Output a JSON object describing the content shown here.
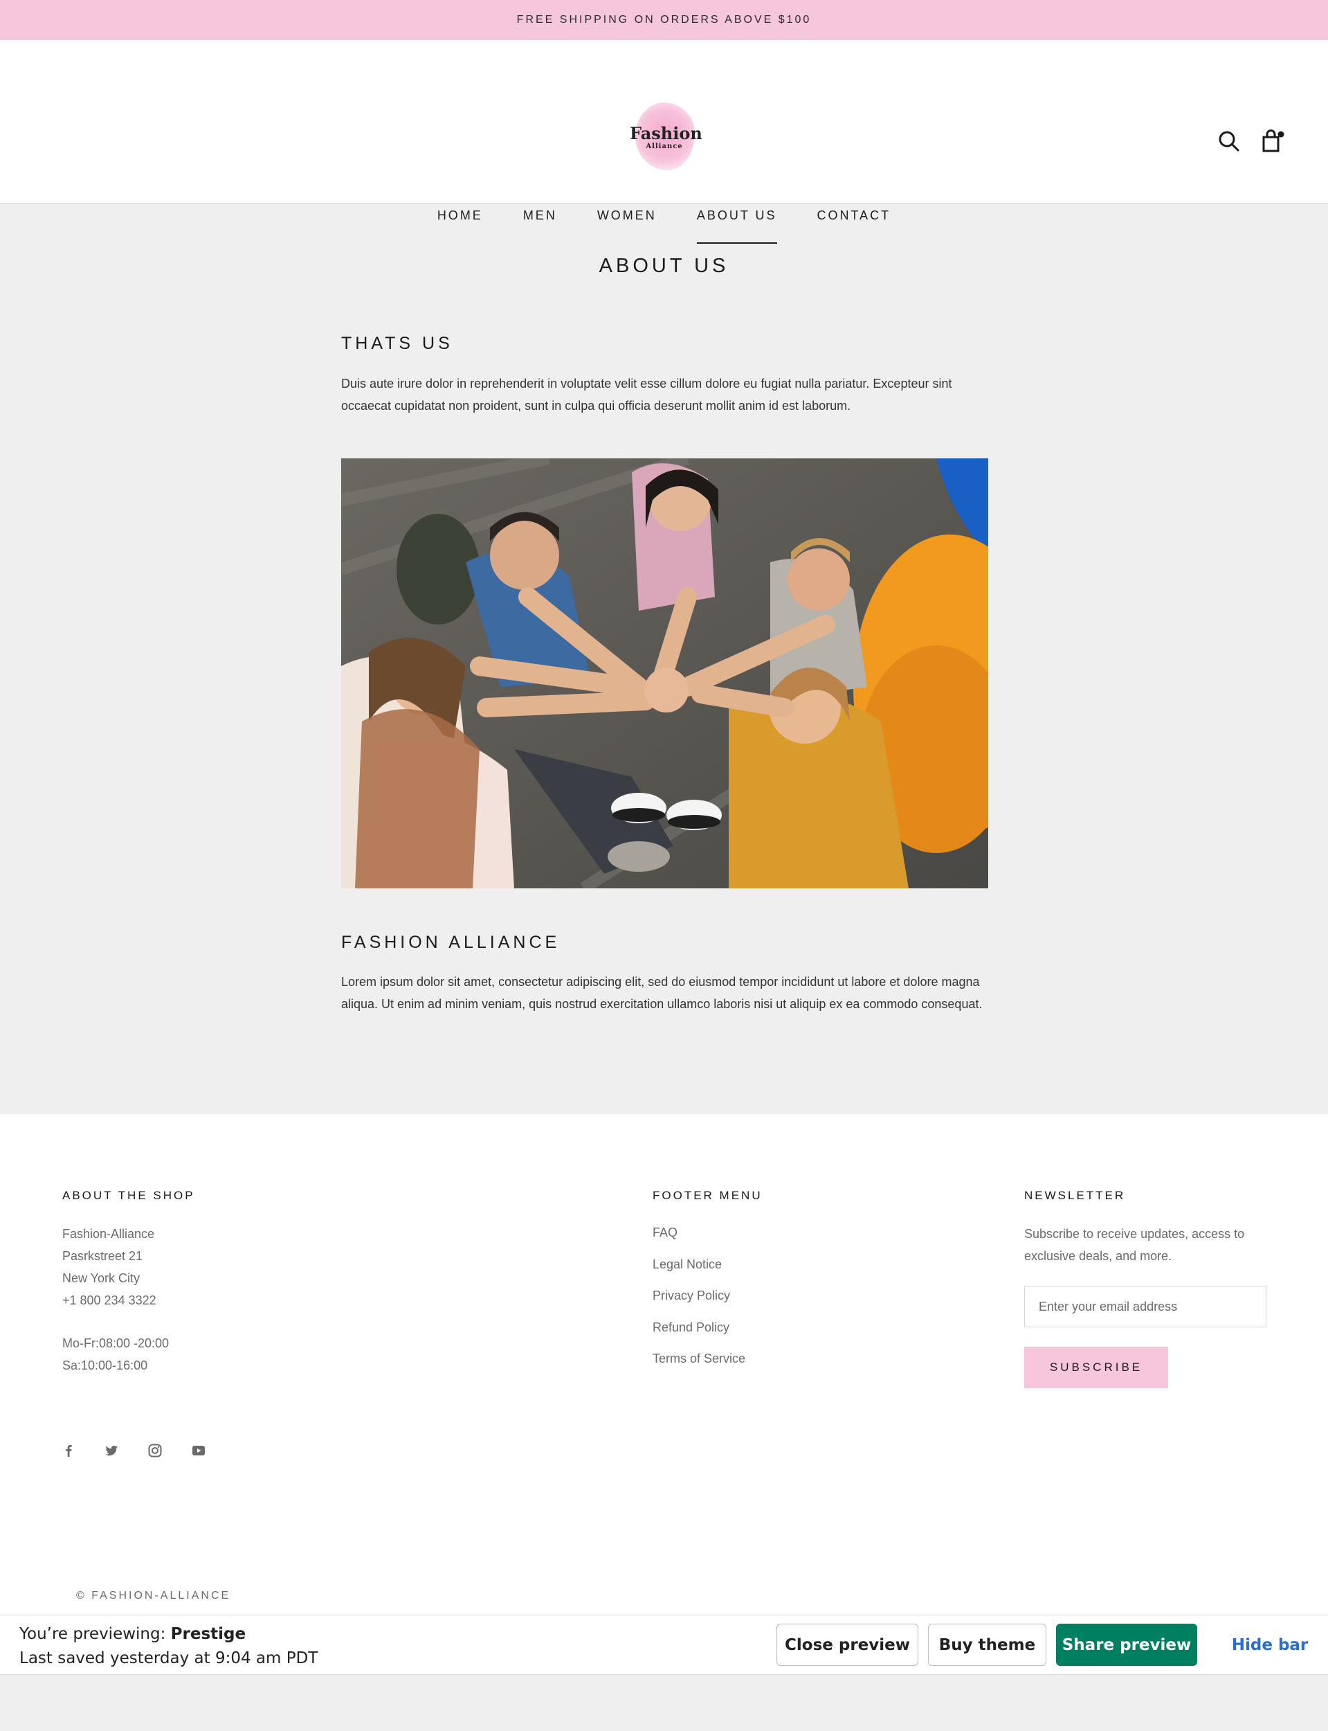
{
  "announcement": "FREE SHIPPING ON ORDERS ABOVE $100",
  "logo": {
    "line1": "Fashion",
    "line2": "Alliance"
  },
  "icons": {
    "search": "search-icon",
    "cart": "shopping-bag-icon"
  },
  "nav": {
    "items": [
      {
        "label": "HOME"
      },
      {
        "label": "MEN"
      },
      {
        "label": "WOMEN"
      },
      {
        "label": "ABOUT US",
        "active": true
      },
      {
        "label": "CONTACT"
      }
    ]
  },
  "page": {
    "title": "ABOUT US",
    "section1": {
      "heading": "THATS US",
      "text": "Duis aute irure dolor in reprehenderit in voluptate velit esse cillum dolore eu fugiat nulla pariatur. Excepteur sint occaecat cupidatat non proident, sunt in culpa qui officia deserunt mollit anim id est laborum."
    },
    "section2": {
      "heading": "FASHION ALLIANCE",
      "text": "Lorem ipsum dolor sit amet, consectetur adipiscing elit, sed do eiusmod tempor incididunt ut labore et dolore magna aliqua. Ut enim ad minim veniam, quis nostrud exercitation ullamco laboris nisi ut aliquip ex ea commodo consequat."
    }
  },
  "footer": {
    "about": {
      "heading": "ABOUT THE SHOP",
      "lines": [
        "Fashion-Alliance",
        "Pasrkstreet 21",
        "New York City",
        "+1 800 234 3322"
      ],
      "hours": [
        "Mo-Fr:08:00 -20:00",
        "Sa:10:00-16:00"
      ]
    },
    "menu": {
      "heading": "FOOTER MENU",
      "links": [
        "FAQ",
        "Legal Notice",
        "Privacy Policy",
        "Refund Policy",
        "Terms of Service"
      ]
    },
    "newsletter": {
      "heading": "NEWSLETTER",
      "text": "Subscribe to receive updates, access to exclusive deals, and more.",
      "placeholder": "Enter your email address",
      "button": "SUBSCRIBE"
    },
    "social": [
      "facebook-icon",
      "twitter-icon",
      "instagram-icon",
      "youtube-icon"
    ],
    "copyright": "© FASHION-ALLIANCE"
  },
  "preview_bar": {
    "previewing_prefix": "You’re previewing: ",
    "theme_name": "Prestige",
    "saved": "Last saved yesterday at 9:04 am PDT",
    "close": "Close preview",
    "buy": "Buy theme",
    "share": "Share preview",
    "hide": "Hide bar",
    "share_color": "#008060",
    "hide_color": "#2c6ecb"
  },
  "colors": {
    "announcement_bg": "#f5c6dc",
    "page_bg": "#efefef",
    "accent_pink": "#f5c6dc"
  }
}
